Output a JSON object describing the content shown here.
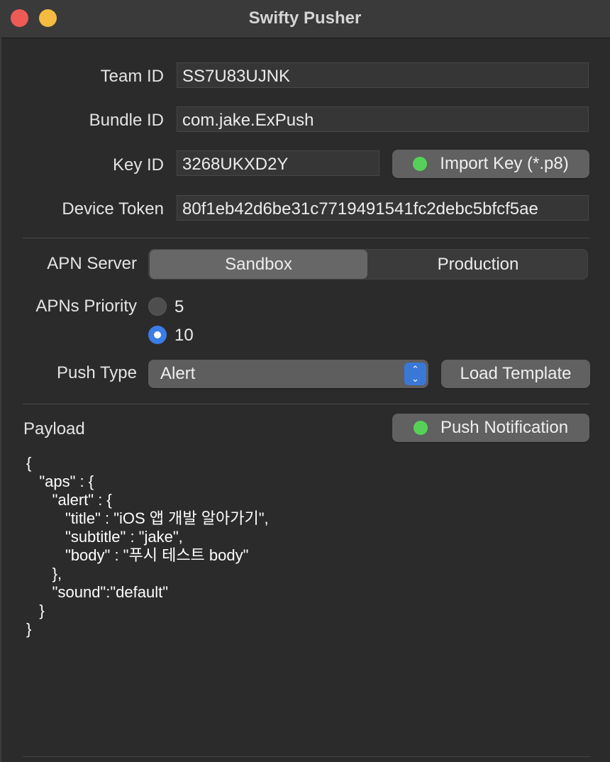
{
  "window": {
    "title": "Swifty Pusher"
  },
  "fields": {
    "team_id": {
      "label": "Team ID",
      "value": "SS7U83UJNK"
    },
    "bundle_id": {
      "label": "Bundle ID",
      "value": "com.jake.ExPush"
    },
    "key_id": {
      "label": "Key ID",
      "value": "3268UKXD2Y"
    },
    "device_token": {
      "label": "Device Token",
      "value": "80f1eb42d6be31c7719491541fc2debc5bfcf5ae"
    }
  },
  "import_key_button": {
    "label": "Import Key (*.p8)",
    "status_color": "#57d05a"
  },
  "apn_server": {
    "label": "APN Server",
    "options": [
      "Sandbox",
      "Production"
    ],
    "selected": "Sandbox"
  },
  "priority": {
    "label": "APNs Priority",
    "options": [
      "5",
      "10"
    ],
    "selected": "10"
  },
  "push_type": {
    "label": "Push Type",
    "value": "Alert"
  },
  "load_template_button": {
    "label": "Load Template"
  },
  "payload": {
    "label": "Payload",
    "text": "{\n   \"aps\" : {\n      \"alert\" : {\n         \"title\" : \"iOS 앱 개발 알아가기\",\n         \"subtitle\" : \"jake\",\n         \"body\" : \"푸시 테스트 body\"\n      },\n      \"sound\":\"default\"\n   }\n}"
  },
  "push_notification_button": {
    "label": "Push Notification",
    "status_color": "#57d05a"
  },
  "colors": {
    "accent": "#3b7ce6",
    "background": "#2b2b2b"
  }
}
